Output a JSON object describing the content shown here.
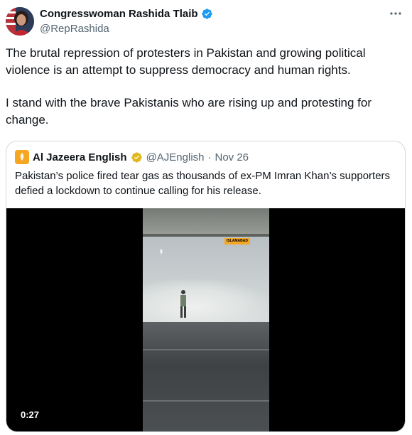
{
  "author": {
    "name": "Congresswoman Rashida Tlaib",
    "handle": "@RepRashida",
    "icons": {
      "verified": "verified-badge-icon",
      "more": "more-icon"
    }
  },
  "tweet": {
    "paragraphs": [
      "The brutal repression of protesters in Pakistan and growing political violence is an attempt to suppress democracy and human rights.",
      "I stand with the brave Pakistanis who are rising up and protesting for change."
    ]
  },
  "quote": {
    "name": "Al Jazeera English",
    "handle": "@AJEnglish",
    "separator": "·",
    "date": "Nov 26",
    "text": "Pakistan’s police fired tear gas as thousands of ex-PM Imran Khan’s supporters defied a lockdown to continue calling for his release.",
    "video": {
      "duration": "0:27",
      "location_tag": "ISLAMABAD"
    }
  },
  "colors": {
    "text_primary": "#0f1419",
    "text_secondary": "#536471",
    "verified_blue": "#1d9bf0",
    "verified_gold": "#e2b719",
    "aj_orange": "#f5a623",
    "border": "#cfd9de"
  }
}
